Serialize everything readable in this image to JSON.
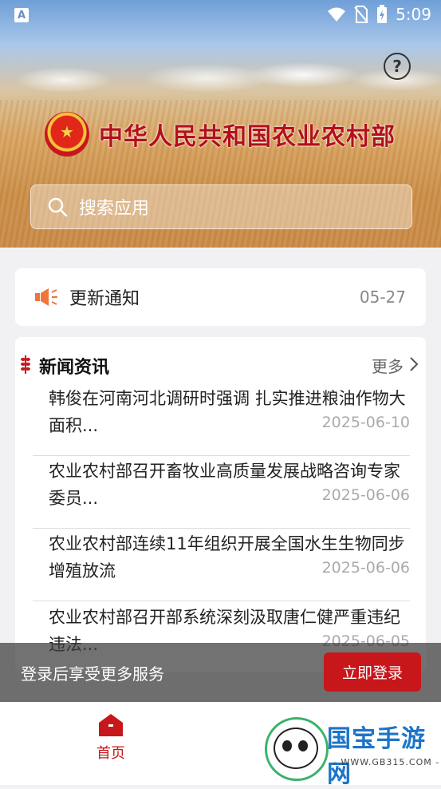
{
  "status_bar": {
    "app_badge": "A",
    "time": "5:09"
  },
  "header": {
    "brand_title": "中华人民共和国农业农村部",
    "help_icon": "question-circle-icon",
    "search_placeholder": "搜索应用"
  },
  "notice": {
    "label": "更新通知",
    "date": "05-27"
  },
  "news": {
    "title": "新闻资讯",
    "more_label": "更多",
    "items": [
      {
        "text": "韩俊在河南河北调研时强调 扎实推进粮油作物大面积...",
        "date": "2025-06-10"
      },
      {
        "text": "农业农村部召开畜牧业高质量发展战略咨询专家委员...",
        "date": "2025-06-06"
      },
      {
        "text": "农业农村部连续11年组织开展全国水生生物同步增殖放流",
        "date": "2025-06-06"
      },
      {
        "text": "农业农村部召开部系统深刻汲取唐仁健严重违纪违法...",
        "date": "2025-06-05"
      }
    ]
  },
  "login_bar": {
    "message": "登录后享受更多服务",
    "button_label": "立即登录"
  },
  "tabbar": {
    "home_label": "首页"
  },
  "watermark": {
    "title": "国宝手游网",
    "url": "- WWW.GB315.COM -"
  },
  "colors": {
    "accent": "#c8171b",
    "brand": "#b3101a",
    "watermark": "#1d74c8"
  }
}
